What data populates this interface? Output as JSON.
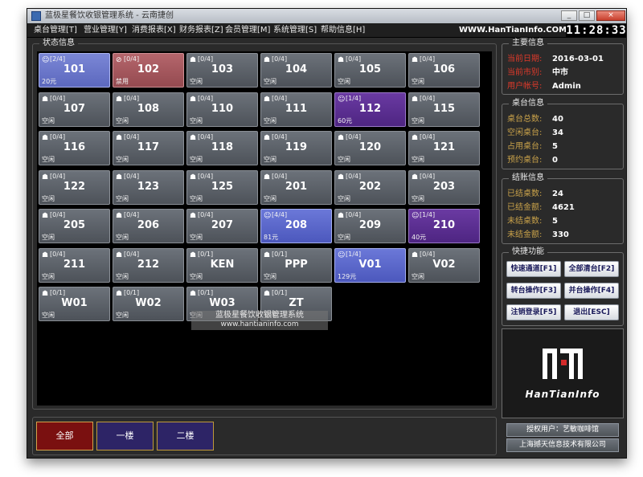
{
  "window": {
    "title": "蓝极星餐饮收银管理系统 - 云南捷创",
    "controls": [
      "_",
      "□",
      "×"
    ]
  },
  "menu": {
    "items": [
      "桌台管理[T]",
      "营业管理[Y]",
      "消费报表[X]",
      "财务报表[Z]",
      "会员管理[M]",
      "系统管理[S]",
      "帮助信息[H]"
    ],
    "site_url": "WWW.HanTianInfo.COM",
    "clock": "11:28:33"
  },
  "status": {
    "title": "状态信息",
    "tables": [
      {
        "name": "101",
        "count": "[2/4]",
        "status": "20元",
        "state": "booked",
        "icon": "people-icon"
      },
      {
        "name": "102",
        "count": "[0/4]",
        "status": "禁用",
        "state": "disabled",
        "icon": "ban-icon"
      },
      {
        "name": "103",
        "count": "[0/4]",
        "status": "空闲",
        "state": "free",
        "icon": "bulb-icon"
      },
      {
        "name": "104",
        "count": "[0/4]",
        "status": "空闲",
        "state": "free",
        "icon": "bulb-icon"
      },
      {
        "name": "105",
        "count": "[0/4]",
        "status": "空闲",
        "state": "free",
        "icon": "bulb-icon"
      },
      {
        "name": "106",
        "count": "[0/4]",
        "status": "空闲",
        "state": "free",
        "icon": "bulb-icon"
      },
      {
        "name": "107",
        "count": "[0/4]",
        "status": "空闲",
        "state": "free",
        "icon": "bulb-icon"
      },
      {
        "name": "108",
        "count": "[0/4]",
        "status": "空闲",
        "state": "free",
        "icon": "bulb-icon"
      },
      {
        "name": "110",
        "count": "[0/4]",
        "status": "空闲",
        "state": "free",
        "icon": "bulb-icon"
      },
      {
        "name": "111",
        "count": "[0/4]",
        "status": "空闲",
        "state": "free",
        "icon": "bulb-icon"
      },
      {
        "name": "112",
        "count": "[1/4]",
        "status": "60元",
        "state": "occupied",
        "icon": "people-icon"
      },
      {
        "name": "115",
        "count": "[0/4]",
        "status": "空闲",
        "state": "free",
        "icon": "bulb-icon"
      },
      {
        "name": "116",
        "count": "[0/4]",
        "status": "空闲",
        "state": "free",
        "icon": "bulb-icon"
      },
      {
        "name": "117",
        "count": "[0/4]",
        "status": "空闲",
        "state": "free",
        "icon": "bulb-icon"
      },
      {
        "name": "118",
        "count": "[0/4]",
        "status": "空闲",
        "state": "free",
        "icon": "bulb-icon"
      },
      {
        "name": "119",
        "count": "[0/4]",
        "status": "空闲",
        "state": "free",
        "icon": "bulb-icon"
      },
      {
        "name": "120",
        "count": "[0/4]",
        "status": "空闲",
        "state": "free",
        "icon": "bulb-icon"
      },
      {
        "name": "121",
        "count": "[0/4]",
        "status": "空闲",
        "state": "free",
        "icon": "bulb-icon"
      },
      {
        "name": "122",
        "count": "[0/4]",
        "status": "空闲",
        "state": "free",
        "icon": "bulb-icon"
      },
      {
        "name": "123",
        "count": "[0/4]",
        "status": "空闲",
        "state": "free",
        "icon": "bulb-icon"
      },
      {
        "name": "125",
        "count": "[0/4]",
        "status": "空闲",
        "state": "free",
        "icon": "bulb-icon"
      },
      {
        "name": "201",
        "count": "[0/4]",
        "status": "空闲",
        "state": "free",
        "icon": "bulb-icon"
      },
      {
        "name": "202",
        "count": "[0/4]",
        "status": "空闲",
        "state": "free",
        "icon": "bulb-icon"
      },
      {
        "name": "203",
        "count": "[0/4]",
        "status": "空闲",
        "state": "free",
        "icon": "bulb-icon"
      },
      {
        "name": "205",
        "count": "[0/4]",
        "status": "空闲",
        "state": "free",
        "icon": "bulb-icon"
      },
      {
        "name": "206",
        "count": "[0/4]",
        "status": "空闲",
        "state": "free",
        "icon": "bulb-icon"
      },
      {
        "name": "207",
        "count": "[0/4]",
        "status": "空闲",
        "state": "free",
        "icon": "bulb-icon"
      },
      {
        "name": "208",
        "count": "[4/4]",
        "status": "81元",
        "state": "booked2",
        "icon": "people-icon"
      },
      {
        "name": "209",
        "count": "[0/4]",
        "status": "空闲",
        "state": "free",
        "icon": "bulb-icon"
      },
      {
        "name": "210",
        "count": "[1/4]",
        "status": "40元",
        "state": "occupied",
        "icon": "people-icon"
      },
      {
        "name": "211",
        "count": "[0/4]",
        "status": "空闲",
        "state": "free",
        "icon": "bulb-icon"
      },
      {
        "name": "212",
        "count": "[0/4]",
        "status": "空闲",
        "state": "free",
        "icon": "bulb-icon"
      },
      {
        "name": "KEN",
        "count": "[0/1]",
        "status": "空闲",
        "state": "free",
        "icon": "bulb-icon"
      },
      {
        "name": "PPP",
        "count": "[0/1]",
        "status": "空闲",
        "state": "free",
        "icon": "bulb-icon"
      },
      {
        "name": "V01",
        "count": "[1/4]",
        "status": "129元",
        "state": "booked2",
        "icon": "people-icon"
      },
      {
        "name": "V02",
        "count": "[0/4]",
        "status": "空闲",
        "state": "free",
        "icon": "bulb-icon"
      },
      {
        "name": "W01",
        "count": "[0/1]",
        "status": "空闲",
        "state": "free",
        "icon": "bulb-icon"
      },
      {
        "name": "W02",
        "count": "[0/1]",
        "status": "空闲",
        "state": "free",
        "icon": "bulb-icon"
      },
      {
        "name": "W03",
        "count": "[0/1]",
        "status": "空闲",
        "state": "free",
        "icon": "bulb-icon"
      },
      {
        "name": "ZT",
        "count": "[0/1]",
        "status": "空闲",
        "state": "free",
        "icon": "bulb-icon"
      }
    ]
  },
  "floors": [
    "全部",
    "一楼",
    "二楼"
  ],
  "main_info": {
    "title": "主要信息",
    "rows": [
      {
        "label": "当前日期:",
        "value": "2016-03-01"
      },
      {
        "label": "当前市别:",
        "value": "中市"
      },
      {
        "label": "用户帐号:",
        "value": "Admin"
      }
    ]
  },
  "table_info": {
    "title": "桌台信息",
    "rows": [
      {
        "label": "桌台总数:",
        "value": "40"
      },
      {
        "label": "空闲桌台:",
        "value": "34"
      },
      {
        "label": "占用桌台:",
        "value": "5"
      },
      {
        "label": "预约桌台:",
        "value": "0"
      }
    ]
  },
  "checkout_info": {
    "title": "结账信息",
    "rows": [
      {
        "label": "已结桌数:",
        "value": "24"
      },
      {
        "label": "已结金额:",
        "value": "4621"
      },
      {
        "label": "未结桌数:",
        "value": "5"
      },
      {
        "label": "未结金额:",
        "value": "330"
      }
    ]
  },
  "shortcuts": {
    "title": "快捷功能",
    "buttons": [
      "快速通道[F1]",
      "全部清台[F2]",
      "转台操作[F3]",
      "并台操作[F4]",
      "注销登录[F5]",
      "退出[ESC]"
    ]
  },
  "logo": {
    "text": "HanTianInfo"
  },
  "footer": {
    "licensed_user": "授权用户：艺敏咖啡馆",
    "company": "上海撼天信息技术有限公司"
  },
  "watermark": {
    "line1": "蓝极星餐饮收银管理系统",
    "line2": "www.hantianinfo.com"
  },
  "colors": {
    "free": "#5a5f66",
    "booked": "#6b77cf",
    "disabled": "#a5585e",
    "occupied": "#5e2f93",
    "label_red": "#e03a2a",
    "label_gold": "#c9a24a",
    "floor_active": "#7a1010",
    "floor_inactive": "#2d2466"
  }
}
